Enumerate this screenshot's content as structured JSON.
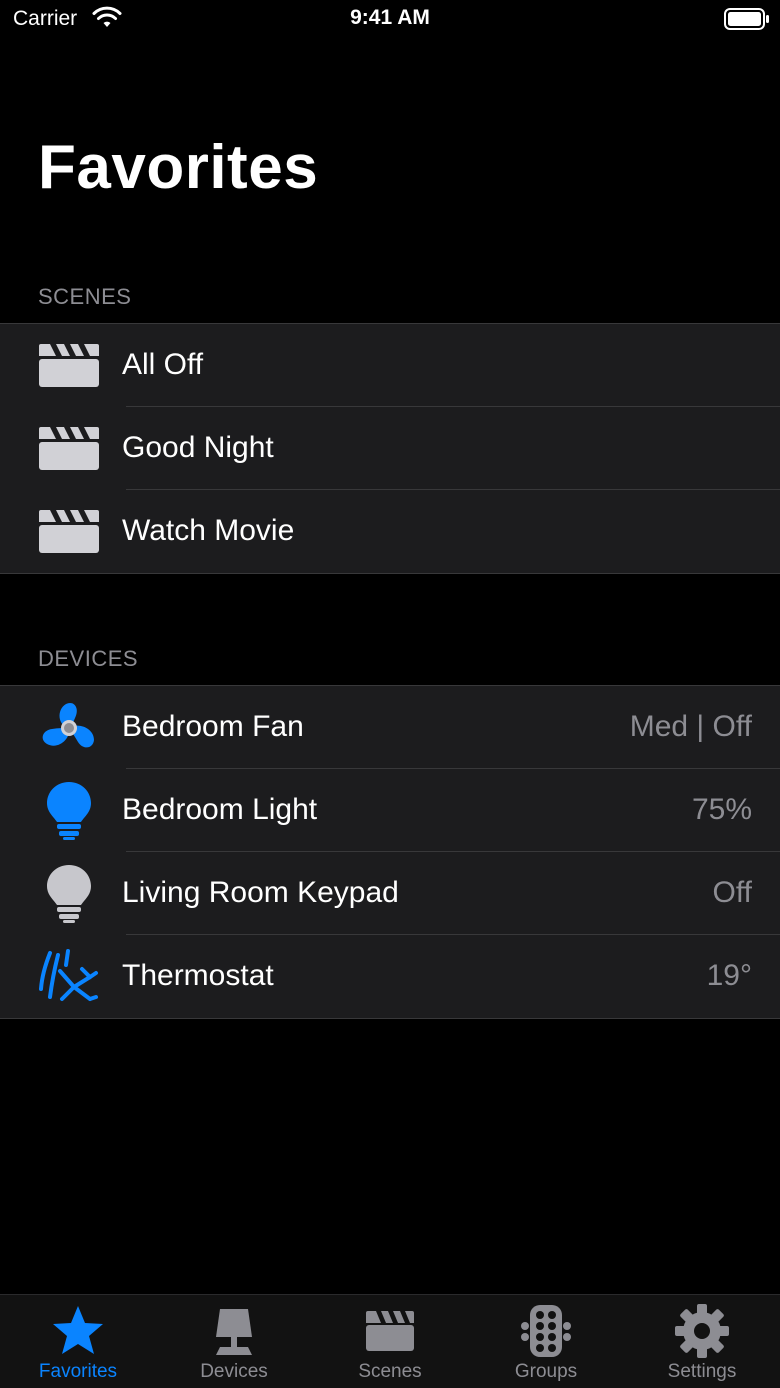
{
  "status_bar": {
    "carrier": "Carrier",
    "time": "9:41 AM"
  },
  "title": "Favorites",
  "colors": {
    "accent": "#0a84ff",
    "icon_gray": "#d1d1d6",
    "secondary_text": "#8d8d93",
    "cell_background": "#1c1c1e"
  },
  "scenes": {
    "header": "SCENES",
    "items": [
      {
        "label": "All Off",
        "icon": "clapperboard-icon"
      },
      {
        "label": "Good Night",
        "icon": "clapperboard-icon"
      },
      {
        "label": "Watch Movie",
        "icon": "clapperboard-icon"
      }
    ]
  },
  "devices": {
    "header": "DEVICES",
    "items": [
      {
        "label": "Bedroom Fan",
        "value": "Med | Off",
        "icon": "fan-icon"
      },
      {
        "label": "Bedroom Light",
        "value": "75%",
        "icon": "lightbulb-on-icon"
      },
      {
        "label": "Living Room Keypad",
        "value": "Off",
        "icon": "lightbulb-off-icon"
      },
      {
        "label": "Thermostat",
        "value": "19°",
        "icon": "thermostat-icon"
      }
    ]
  },
  "tab_bar": {
    "items": [
      {
        "label": "Favorites",
        "icon": "star-icon",
        "active": true
      },
      {
        "label": "Devices",
        "icon": "lamp-icon",
        "active": false
      },
      {
        "label": "Scenes",
        "icon": "clapperboard-icon",
        "active": false
      },
      {
        "label": "Groups",
        "icon": "grid-dots-icon",
        "active": false
      },
      {
        "label": "Settings",
        "icon": "gear-icon",
        "active": false
      }
    ]
  }
}
